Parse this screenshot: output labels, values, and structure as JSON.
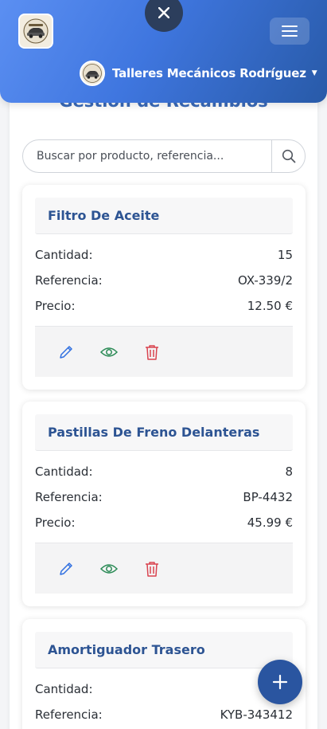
{
  "header": {
    "user_name": "Talleres Mecánicos Rodríguez",
    "colors": {
      "gradient_start": "#5b8ff2",
      "gradient_end": "#285aa8",
      "close_button": "#2c3e5c"
    }
  },
  "page": {
    "title": "Gestión de Recambios"
  },
  "search": {
    "placeholder": "Buscar por producto, referencia..."
  },
  "labels": {
    "quantity": "Cantidad:",
    "reference": "Referencia:",
    "price": "Precio:"
  },
  "products": [
    {
      "name": "Filtro De Aceite",
      "quantity": "15",
      "reference": "OX-339/2",
      "price": "12.50 €"
    },
    {
      "name": "Pastillas De Freno Delanteras",
      "quantity": "8",
      "reference": "BP-4432",
      "price": "45.99 €"
    },
    {
      "name": "Amortiguador Trasero",
      "quantity": "",
      "reference": "KYB-343412",
      "price": ""
    }
  ],
  "icons": {
    "close": "close-icon",
    "menu": "hamburger-icon",
    "search": "search-icon",
    "edit": "pencil-icon",
    "view": "eye-icon",
    "delete": "trash-icon",
    "add": "plus-icon"
  },
  "action_colors": {
    "edit": "#2f6fe0",
    "view": "#2a8a55",
    "delete": "#d9434f",
    "fab": "#2a55a0"
  }
}
